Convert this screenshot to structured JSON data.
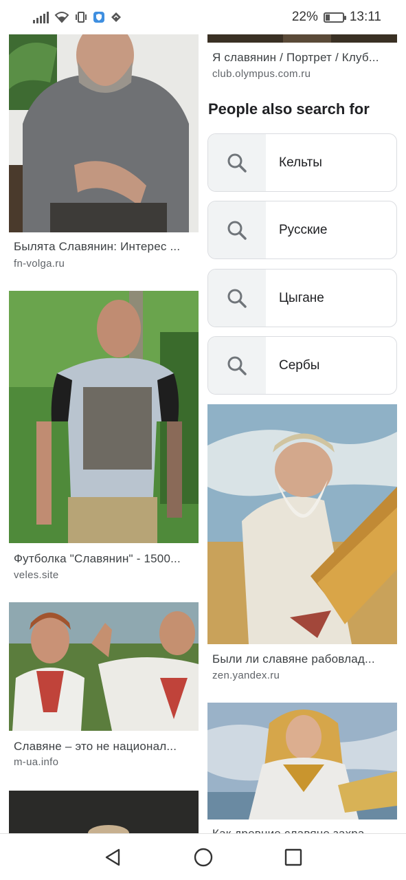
{
  "status_bar": {
    "battery_percent": "22%",
    "time": "13:11"
  },
  "left_column": [
    {
      "caption": "Былята Славянин: Интерес ...",
      "source": "fn-volga.ru"
    },
    {
      "caption": "Футболка \"Славянин\" - 1500...",
      "source": "veles.site"
    },
    {
      "caption": "Славяне – это не национал...",
      "source": "m-ua.info"
    }
  ],
  "right_column": [
    {
      "caption": "Я славянин / Портрет / Клуб...",
      "source": "club.olympus.com.ru"
    },
    {
      "caption": "Были ли славяне рабовлад...",
      "source": "zen.yandex.ru"
    },
    {
      "caption": "Как древние славяне захра...",
      "source": ""
    }
  ],
  "people_also_search": {
    "title": "People also search for",
    "items": [
      {
        "label": "Кельты",
        "icon": "search-icon"
      },
      {
        "label": "Русские",
        "icon": "search-icon"
      },
      {
        "label": "Цыгане",
        "icon": "search-icon"
      },
      {
        "label": "Сербы",
        "icon": "search-icon"
      }
    ]
  },
  "nav_bar": {
    "back_icon": "back-triangle-icon",
    "home_icon": "home-circle-icon",
    "recents_icon": "recents-square-icon"
  },
  "colors": {
    "accent_text": "#202124",
    "source_text": "#5f6368",
    "chip_border": "#dadce0",
    "chip_icon_bg": "#f1f3f4"
  }
}
